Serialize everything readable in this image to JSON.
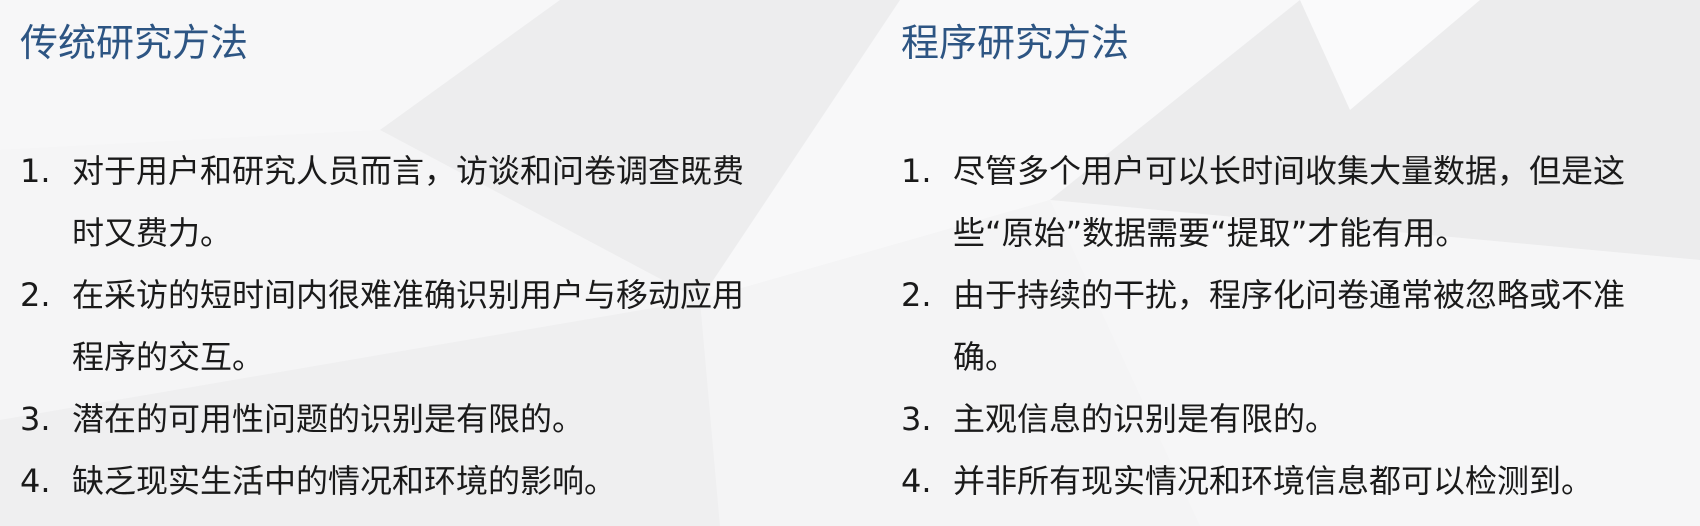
{
  "left": {
    "title": "传统研究方法",
    "items": [
      {
        "number": "1.",
        "text": "对于用户和研究人员而言，访谈和问卷调查既费时又费力。"
      },
      {
        "number": "2.",
        "text": "在采访的短时间内很难准确识别用户与移动应用程序的交互。"
      },
      {
        "number": "3.",
        "text": "潜在的可用性问题的识别是有限的。"
      },
      {
        "number": "4.",
        "text": "缺乏现实生活中的情况和环境的影响。"
      }
    ]
  },
  "right": {
    "title": "程序研究方法",
    "items": [
      {
        "number": "1.",
        "text": "尽管多个用户可以长时间收集大量数据，但是这些“原始”数据需要“提取”才能有用。"
      },
      {
        "number": "2.",
        "text": "由于持续的干扰，程序化问卷通常被忽略或不准确。"
      },
      {
        "number": "3.",
        "text": "主观信息的识别是有限的。"
      },
      {
        "number": "4.",
        "text": "并非所有现实情况和环境信息都可以检测到。"
      }
    ]
  },
  "colors": {
    "heading": "#2d5583",
    "body_text": "#1a1a1a",
    "background": "#f2f2f3"
  }
}
